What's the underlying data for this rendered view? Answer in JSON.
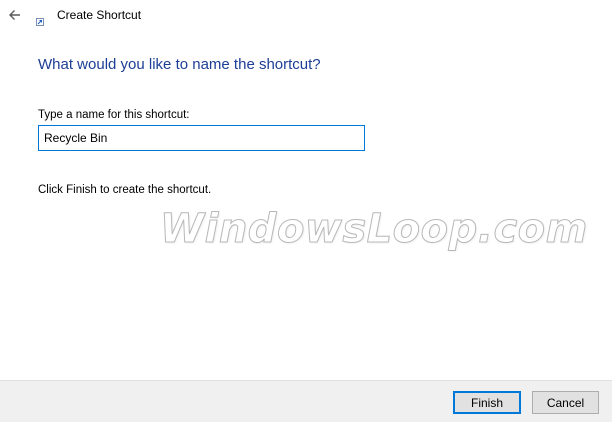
{
  "window": {
    "title": "Create Shortcut",
    "icon": "shortcut-icon",
    "back_icon": "back-arrow-icon"
  },
  "main": {
    "instruction": "What would you like to name the shortcut?",
    "name_label": "Type a name for this shortcut:",
    "name_value": "Recycle Bin",
    "hint": "Click Finish to create the shortcut."
  },
  "watermark": "WindowsLoop.com",
  "buttons": {
    "finish_label": "Finish",
    "cancel_label": "Cancel"
  },
  "colors": {
    "instruction": "#1c3e96",
    "accent": "#0078d7",
    "footer_bg": "#f0f0f0"
  }
}
